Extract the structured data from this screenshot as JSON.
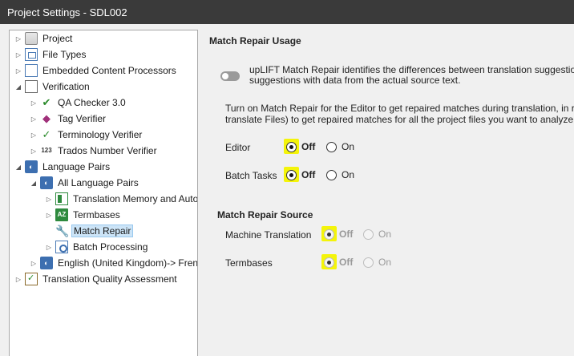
{
  "window": {
    "title": "Project Settings - SDL002"
  },
  "tree": {
    "items": [
      {
        "label": "Project"
      },
      {
        "label": "File Types"
      },
      {
        "label": "Embedded Content Processors"
      },
      {
        "label": "Verification"
      },
      {
        "label": "QA Checker 3.0"
      },
      {
        "label": "Tag Verifier"
      },
      {
        "label": "Terminology Verifier"
      },
      {
        "label": "Trados Number Verifier"
      },
      {
        "label": "Language Pairs"
      },
      {
        "label": "All Language Pairs"
      },
      {
        "label": "Translation Memory and Auto"
      },
      {
        "label": "Termbases"
      },
      {
        "label": "Match Repair"
      },
      {
        "label": "Batch Processing"
      },
      {
        "label": "English (United Kingdom)-> French"
      },
      {
        "label": "Translation Quality Assessment"
      }
    ]
  },
  "main": {
    "usage_title": "Match Repair Usage",
    "uplift_line1": "upLIFT Match Repair identifies the differences between translation suggestions and",
    "uplift_line2": "suggestions with data from the actual source text.",
    "turn_on_line1": "Turn on Match Repair for the Editor to get repaired matches during translation, in real tim",
    "turn_on_line2": "translate Files) to get repaired matches for all the project files you want to analyze or pre-t",
    "editor": {
      "label": "Editor",
      "off": "Off",
      "on": "On"
    },
    "batch_tasks": {
      "label": "Batch Tasks",
      "off": "Off",
      "on": "On"
    },
    "source_title": "Match Repair Source",
    "machine_translation": {
      "label": "Machine Translation",
      "off": "Off",
      "on": "On"
    },
    "termbases": {
      "label": "Termbases",
      "off": "Off",
      "on": "On"
    }
  },
  "colors": {
    "highlight": "#f4f40a",
    "titlebar": "#3a3a3a",
    "selection": "#cce4f7"
  }
}
